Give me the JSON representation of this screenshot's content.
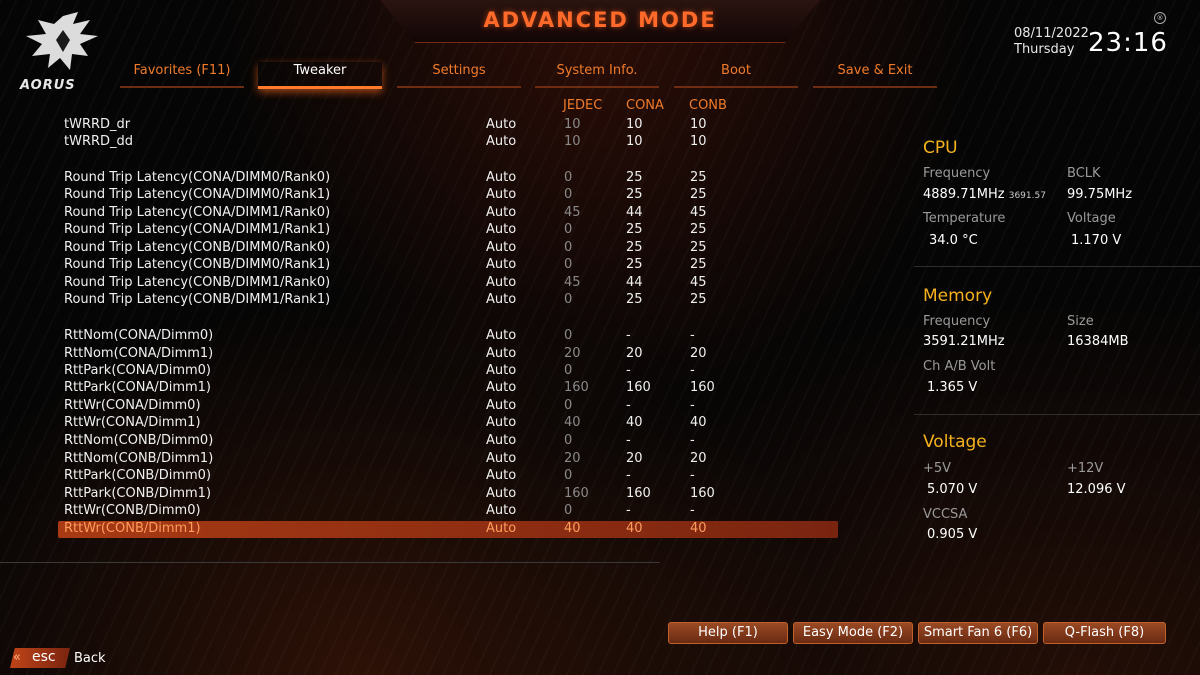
{
  "header": {
    "title": "ADVANCED MODE",
    "brand": "AORUS",
    "date": "08/11/2022",
    "day": "Thursday",
    "time": "23:16",
    "reg_mark": "®"
  },
  "tabs": [
    {
      "label": "Favorites (F11)",
      "active": false
    },
    {
      "label": "Tweaker",
      "active": true
    },
    {
      "label": "Settings",
      "active": false
    },
    {
      "label": "System Info.",
      "active": false
    },
    {
      "label": "Boot",
      "active": false
    },
    {
      "label": "Save & Exit",
      "active": false
    }
  ],
  "columns": {
    "jedec": "JEDEC",
    "cona": "CONA",
    "conb": "CONB"
  },
  "rows": [
    {
      "name": "tWRRD_dr",
      "value": "Auto",
      "jedec": "10",
      "cona": "10",
      "conb": "10"
    },
    {
      "name": "tWRRD_dd",
      "value": "Auto",
      "jedec": "10",
      "cona": "10",
      "conb": "10"
    },
    {
      "name": "Round Trip Latency(CONA/DIMM0/Rank0)",
      "value": "Auto",
      "jedec": "0",
      "cona": "25",
      "conb": "25"
    },
    {
      "name": "Round Trip Latency(CONA/DIMM0/Rank1)",
      "value": "Auto",
      "jedec": "0",
      "cona": "25",
      "conb": "25"
    },
    {
      "name": "Round Trip Latency(CONA/DIMM1/Rank0)",
      "value": "Auto",
      "jedec": "45",
      "cona": "44",
      "conb": "45"
    },
    {
      "name": "Round Trip Latency(CONA/DIMM1/Rank1)",
      "value": "Auto",
      "jedec": "0",
      "cona": "25",
      "conb": "25"
    },
    {
      "name": "Round Trip Latency(CONB/DIMM0/Rank0)",
      "value": "Auto",
      "jedec": "0",
      "cona": "25",
      "conb": "25"
    },
    {
      "name": "Round Trip Latency(CONB/DIMM0/Rank1)",
      "value": "Auto",
      "jedec": "0",
      "cona": "25",
      "conb": "25"
    },
    {
      "name": "Round Trip Latency(CONB/DIMM1/Rank0)",
      "value": "Auto",
      "jedec": "45",
      "cona": "44",
      "conb": "45"
    },
    {
      "name": "Round Trip Latency(CONB/DIMM1/Rank1)",
      "value": "Auto",
      "jedec": "0",
      "cona": "25",
      "conb": "25"
    },
    {
      "name": "RttNom(CONA/Dimm0)",
      "value": "Auto",
      "jedec": "0",
      "cona": "-",
      "conb": "-"
    },
    {
      "name": "RttNom(CONA/Dimm1)",
      "value": "Auto",
      "jedec": "20",
      "cona": "20",
      "conb": "20"
    },
    {
      "name": "RttPark(CONA/Dimm0)",
      "value": "Auto",
      "jedec": "0",
      "cona": "-",
      "conb": "-"
    },
    {
      "name": "RttPark(CONA/Dimm1)",
      "value": "Auto",
      "jedec": "160",
      "cona": "160",
      "conb": "160"
    },
    {
      "name": "RttWr(CONA/Dimm0)",
      "value": "Auto",
      "jedec": "0",
      "cona": "-",
      "conb": "-"
    },
    {
      "name": "RttWr(CONA/Dimm1)",
      "value": "Auto",
      "jedec": "40",
      "cona": "40",
      "conb": "40"
    },
    {
      "name": "RttNom(CONB/Dimm0)",
      "value": "Auto",
      "jedec": "0",
      "cona": "-",
      "conb": "-"
    },
    {
      "name": "RttNom(CONB/Dimm1)",
      "value": "Auto",
      "jedec": "20",
      "cona": "20",
      "conb": "20"
    },
    {
      "name": "RttPark(CONB/Dimm0)",
      "value": "Auto",
      "jedec": "0",
      "cona": "-",
      "conb": "-"
    },
    {
      "name": "RttPark(CONB/Dimm1)",
      "value": "Auto",
      "jedec": "160",
      "cona": "160",
      "conb": "160"
    },
    {
      "name": "RttWr(CONB/Dimm0)",
      "value": "Auto",
      "jedec": "0",
      "cona": "-",
      "conb": "-"
    },
    {
      "name": "RttWr(CONB/Dimm1)",
      "value": "Auto",
      "jedec": "40",
      "cona": "40",
      "conb": "40",
      "selected": true
    }
  ],
  "cpu": {
    "title": "CPU",
    "frequency_label": "Frequency",
    "frequency": "4889.71MHz",
    "frequency_sub": "3691.57",
    "bclk_label": "BCLK",
    "bclk": "99.75MHz",
    "temperature_label": "Temperature",
    "temperature": "34.0 °C",
    "voltage_label": "Voltage",
    "voltage": "1.170 V"
  },
  "memory": {
    "title": "Memory",
    "frequency_label": "Frequency",
    "frequency": "3591.21MHz",
    "size_label": "Size",
    "size": "16384MB",
    "chab_label": "Ch A/B Volt",
    "chab": "1.365 V"
  },
  "voltage": {
    "title": "Voltage",
    "p5v_label": "+5V",
    "p5v": "5.070 V",
    "p12v_label": "+12V",
    "p12v": "12.096 V",
    "vccsa_label": "VCCSA",
    "vccsa": "0.905 V"
  },
  "footer": {
    "buttons": [
      "Help (F1)",
      "Easy Mode (F2)",
      "Smart Fan 6 (F6)",
      "Q-Flash (F8)"
    ],
    "esc_label": "esc",
    "back_label": "Back"
  },
  "colors": {
    "accent": "#ff7a2a",
    "panel_title": "#f5b21e",
    "selected_row": "#a83a14"
  }
}
